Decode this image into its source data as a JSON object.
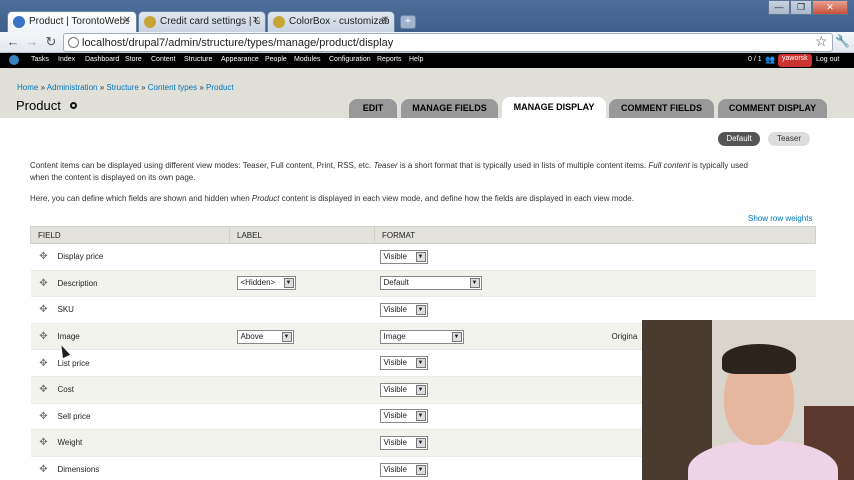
{
  "browser": {
    "tabs": [
      {
        "title": "Product | TorontoWebsiteD",
        "favicon_color": "#3a73c4",
        "active": true
      },
      {
        "title": "Credit card settings | Uberc",
        "favicon_color": "#c8a335",
        "active": false
      },
      {
        "title": "ColorBox - customizable lig",
        "favicon_color": "#c8a335",
        "active": false
      }
    ],
    "close_glyph": "✕",
    "new_tab_glyph": "+",
    "window_controls": [
      "—",
      "❐",
      "✕"
    ],
    "nav": {
      "back": "←",
      "forward": "→",
      "reload": "↻",
      "star": "☆",
      "wrench": "🔧"
    },
    "url": "localhost/drupal7/admin/structure/types/manage/product/display"
  },
  "drupal_toolbar": {
    "items": [
      "Tasks",
      "Index",
      "Dashboard",
      "Store",
      "Content",
      "Structure",
      "Appearance",
      "People",
      "Modules",
      "Configuration",
      "Reports",
      "Help"
    ],
    "count": "0 / 1",
    "people_icon": "👥",
    "user": "yaworsk",
    "logout": "Log out"
  },
  "breadcrumb": {
    "items": [
      "Home",
      "Administration",
      "Structure",
      "Content types",
      "Product"
    ],
    "separator": " » "
  },
  "page": {
    "title": "Product",
    "tabs": [
      "EDIT",
      "MANAGE FIELDS",
      "MANAGE DISPLAY",
      "COMMENT FIELDS",
      "COMMENT DISPLAY"
    ],
    "active_tab": "MANAGE DISPLAY",
    "view_modes": [
      "Default",
      "Teaser"
    ],
    "paragraph1": {
      "a": "Content items can be displayed using different view modes: Teaser, Full content, Print, RSS, etc. ",
      "b": "Teaser",
      "c": " is a short format that is typically used in lists of multiple content items. ",
      "d": "Full content",
      "e": " is typically used",
      "f": "when the content is displayed on its own page."
    },
    "paragraph2": {
      "a": "Here, you can define which fields are shown and hidden when ",
      "b": "Product",
      "c": " content is displayed in each view mode, and define how the fields are displayed in each view mode."
    },
    "show_row_weights": "Show row weights"
  },
  "table": {
    "headers": [
      "FIELD",
      "LABEL",
      "FORMAT"
    ],
    "drag_glyph": "✥",
    "arrow_glyph": "▼",
    "rows": [
      {
        "field": "Display price",
        "label": "",
        "format": "Visible",
        "extra": ""
      },
      {
        "field": "Description",
        "label": "<Hidden>",
        "format": "Default",
        "extra": ""
      },
      {
        "field": "SKU",
        "label": "",
        "format": "Visible",
        "extra": ""
      },
      {
        "field": "Image",
        "label": "Above",
        "format": "Image",
        "extra": "Origina"
      },
      {
        "field": "List price",
        "label": "",
        "format": "Visible",
        "extra": ""
      },
      {
        "field": "Cost",
        "label": "",
        "format": "Visible",
        "extra": ""
      },
      {
        "field": "Sell price",
        "label": "",
        "format": "Visible",
        "extra": ""
      },
      {
        "field": "Weight",
        "label": "",
        "format": "Visible",
        "extra": ""
      },
      {
        "field": "Dimensions",
        "label": "",
        "format": "Visible",
        "extra": ""
      }
    ]
  }
}
